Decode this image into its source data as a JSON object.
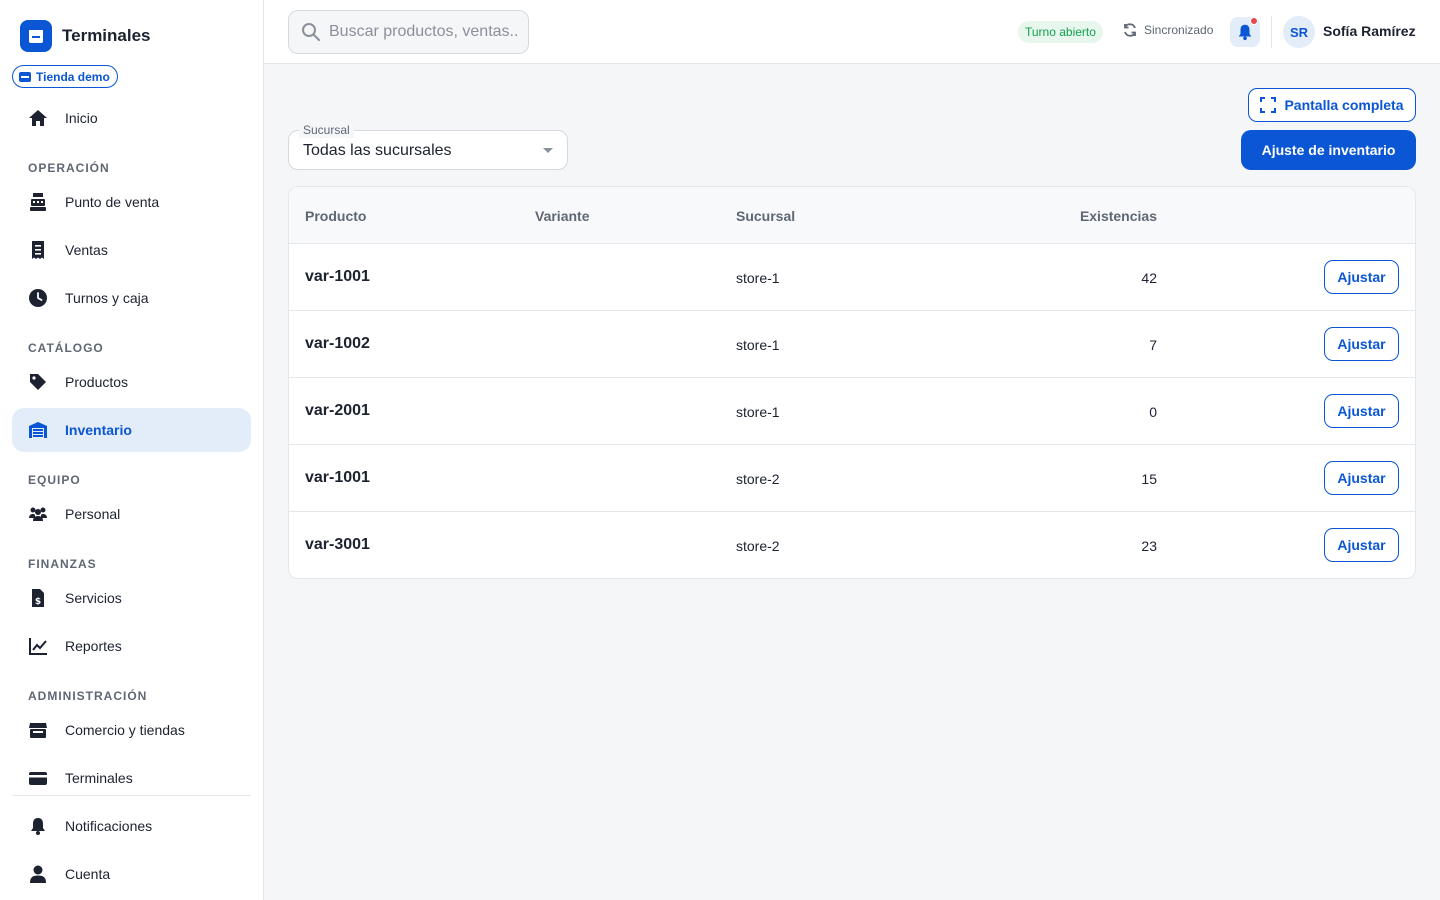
{
  "app": {
    "title": "Terminales",
    "store_badge": "Tienda demo"
  },
  "colors": {
    "accent": "#0b56d4",
    "success": "#12a150",
    "danger": "#e5484d"
  },
  "sidebar": {
    "home": {
      "label": "Inicio",
      "icon": "home-icon"
    },
    "sections": [
      {
        "label": "OPERACIÓN",
        "items": [
          {
            "label": "Punto de venta",
            "icon": "cash-register-icon"
          },
          {
            "label": "Ventas",
            "icon": "receipt-icon"
          },
          {
            "label": "Turnos y caja",
            "icon": "clock-icon"
          }
        ]
      },
      {
        "label": "CATÁLOGO",
        "items": [
          {
            "label": "Productos",
            "icon": "tag-icon"
          },
          {
            "label": "Inventario",
            "icon": "warehouse-icon",
            "active": true
          }
        ]
      },
      {
        "label": "EQUIPO",
        "items": [
          {
            "label": "Personal",
            "icon": "users-icon"
          }
        ]
      },
      {
        "label": "FINANZAS",
        "items": [
          {
            "label": "Servicios",
            "icon": "invoice-dollar-icon"
          },
          {
            "label": "Reportes",
            "icon": "line-chart-icon"
          }
        ]
      },
      {
        "label": "ADMINISTRACIÓN",
        "items": [
          {
            "label": "Comercio y tiendas",
            "icon": "store-icon"
          },
          {
            "label": "Terminales",
            "icon": "credit-card-icon"
          }
        ]
      }
    ],
    "bottom": [
      {
        "label": "Notificaciones",
        "icon": "bell-icon"
      },
      {
        "label": "Cuenta",
        "icon": "user-icon"
      }
    ]
  },
  "topbar": {
    "search_placeholder": "Buscar productos, ventas...",
    "shift_status": "Turno abierto",
    "sync_status": "Sincronizado",
    "user_initials": "SR",
    "user_name": "Sofía Ramírez"
  },
  "toolbar": {
    "fullscreen_label": "Pantalla completa",
    "adjust_inventory_label": "Ajuste de inventario",
    "branch_label": "Sucursal",
    "branch_value": "Todas las sucursales"
  },
  "table": {
    "headers": {
      "product": "Producto",
      "variant": "Variante",
      "branch": "Sucursal",
      "stock": "Existencias"
    },
    "action_label": "Ajustar",
    "rows": [
      {
        "product": "var-1001",
        "variant": "",
        "branch": "store-1",
        "stock": "42"
      },
      {
        "product": "var-1002",
        "variant": "",
        "branch": "store-1",
        "stock": "7"
      },
      {
        "product": "var-2001",
        "variant": "",
        "branch": "store-1",
        "stock": "0"
      },
      {
        "product": "var-1001",
        "variant": "",
        "branch": "store-2",
        "stock": "15"
      },
      {
        "product": "var-3001",
        "variant": "",
        "branch": "store-2",
        "stock": "23"
      }
    ]
  }
}
